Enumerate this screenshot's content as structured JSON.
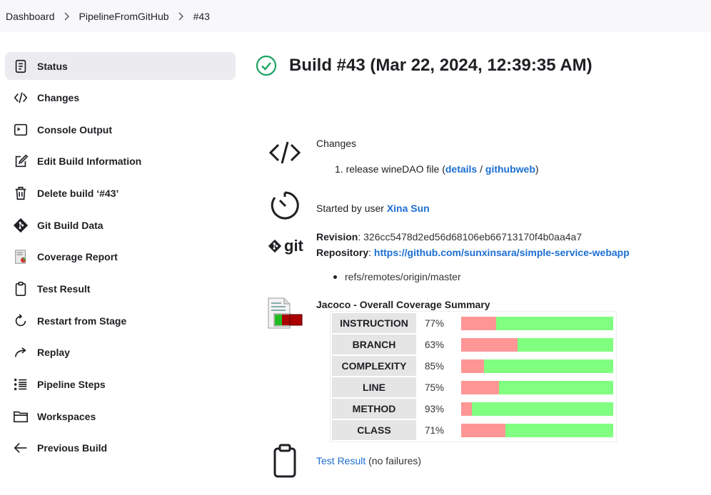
{
  "breadcrumb": {
    "items": [
      "Dashboard",
      "PipelineFromGitHub",
      "#43"
    ]
  },
  "sidebar": {
    "items": [
      {
        "label": "Status",
        "icon": "document-icon"
      },
      {
        "label": "Changes",
        "icon": "code-icon"
      },
      {
        "label": "Console Output",
        "icon": "terminal-icon"
      },
      {
        "label": "Edit Build Information",
        "icon": "edit-icon"
      },
      {
        "label": "Delete build ‘#43’",
        "icon": "trash-icon"
      },
      {
        "label": "Git Build Data",
        "icon": "git-icon"
      },
      {
        "label": "Coverage Report",
        "icon": "coverage-icon"
      },
      {
        "label": "Test Result",
        "icon": "clipboard-icon"
      },
      {
        "label": "Restart from Stage",
        "icon": "restart-icon"
      },
      {
        "label": "Replay",
        "icon": "replay-icon"
      },
      {
        "label": "Pipeline Steps",
        "icon": "steps-icon"
      },
      {
        "label": "Workspaces",
        "icon": "folder-icon"
      },
      {
        "label": "Previous Build",
        "icon": "arrow-left-icon"
      }
    ]
  },
  "main": {
    "title": "Build #43 (Mar 22, 2024, 12:39:35 AM)",
    "changes": {
      "heading": "Changes",
      "entries": [
        {
          "number": "1.",
          "text": "release wineDAO file (",
          "details": "details",
          "slash": " / ",
          "githubweb": "githubweb",
          "close": ")"
        }
      ]
    },
    "started": {
      "text": "Started by user ",
      "user": "Xina Sun"
    },
    "git": {
      "logo_text": "git",
      "revision_label": "Revision",
      "revision_value": ": 326cc5478d2ed56d68106eb66713170f4b0aa4a7",
      "repository_label": "Repository",
      "repository_sep": ": ",
      "repository_url": "https://github.com/sunxinsara/simple-service-webapp",
      "branches": [
        "refs/remotes/origin/master"
      ]
    },
    "jacoco": {
      "heading": "Jacoco - Overall Coverage Summary",
      "rows": [
        {
          "name": "INSTRUCTION",
          "pct": "77%",
          "covered": 0.77
        },
        {
          "name": "BRANCH",
          "pct": "63%",
          "covered": 0.63
        },
        {
          "name": "COMPLEXITY",
          "pct": "85%",
          "covered": 0.85
        },
        {
          "name": "LINE",
          "pct": "75%",
          "covered": 0.75
        },
        {
          "name": "METHOD",
          "pct": "93%",
          "covered": 0.93
        },
        {
          "name": "CLASS",
          "pct": "71%",
          "covered": 0.71
        }
      ],
      "covered_color": "#80ff80",
      "missed_color": "#ff9696"
    },
    "test_result": {
      "link": "Test Result",
      "suffix": " (no failures)"
    }
  },
  "colors": {
    "success": "#1ea362",
    "link": "#1c6ed1",
    "active_bg": "#ececf0"
  }
}
